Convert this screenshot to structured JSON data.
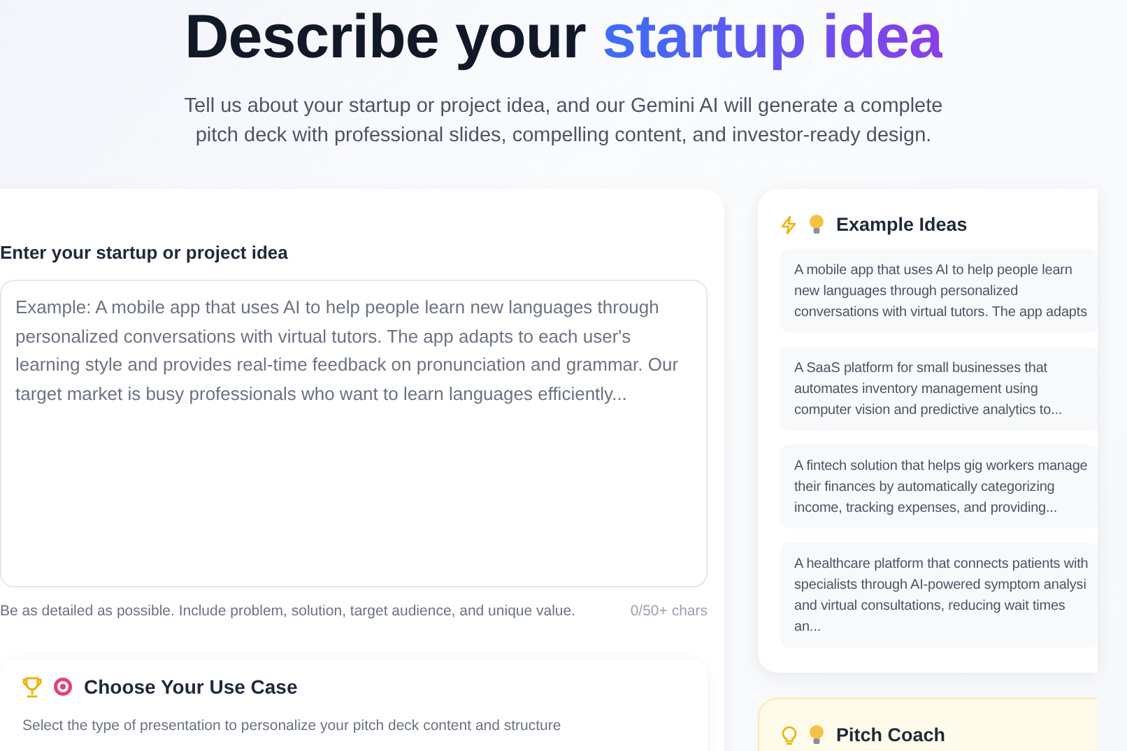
{
  "header": {
    "title": "Describe your ",
    "title_highlight": "startup idea",
    "subtitle": "Tell us about your startup or project idea, and our Gemini AI will generate a complete pitch deck with professional slides, compelling content, and investor-ready design."
  },
  "idea_form": {
    "label": "Enter your startup or project idea",
    "placeholder": "Example: A mobile app that uses AI to help people learn new languages through personalized conversations with virtual tutors. The app adapts to each user's learning style and provides real-time feedback on pronunciation and grammar. Our target market is busy professionals who want to learn languages efficiently...",
    "hint": "Be as detailed as possible. Include problem, solution, target audience, and unique value.",
    "counter": "0/50+ chars"
  },
  "use_case": {
    "title": "Choose Your Use Case",
    "description": "Select the type of presentation to personalize your pitch deck content and structure"
  },
  "example_ideas": {
    "title": "Example Ideas",
    "items": [
      "A mobile app that uses AI to help people learn new languages through personalized conversations with virtual tutors. The app adapts",
      "A SaaS platform for small businesses that automates inventory management using computer vision and predictive analytics to...",
      "A fintech solution that helps gig workers manage their finances by automatically categorizing income, tracking expenses, and providing...",
      "A healthcare platform that connects patients with specialists through AI-powered symptom analysi and virtual consultations, reducing wait times an..."
    ]
  },
  "pitch_coach": {
    "title": "Pitch Coach"
  }
}
